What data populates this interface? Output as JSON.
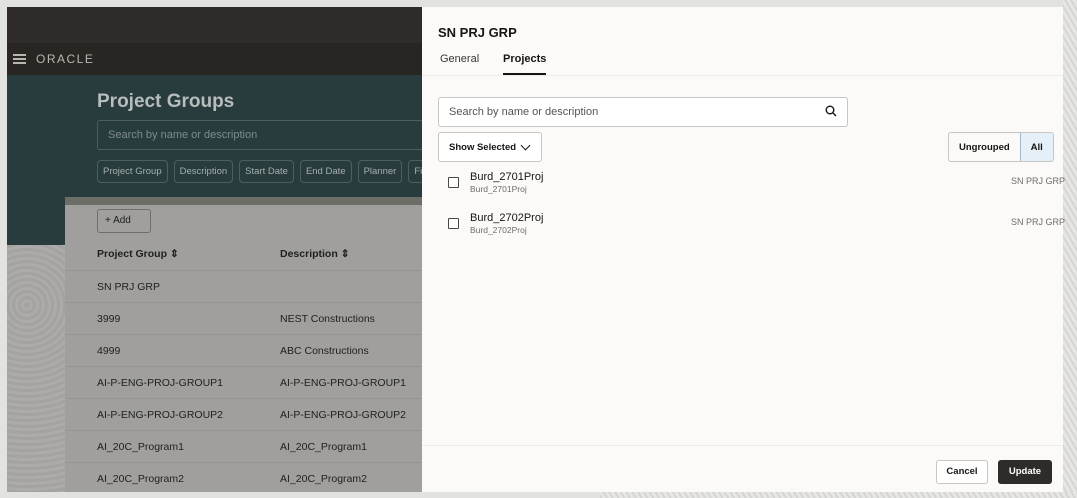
{
  "app": {
    "brand": "ORACLE",
    "page_title": "Project Groups",
    "search_placeholder": "Search by name or description",
    "filters": [
      "Project Group",
      "Description",
      "Start Date",
      "End Date",
      "Planner",
      "Filt"
    ],
    "add_label": "Add",
    "columns": [
      "Project Group",
      "Description"
    ],
    "rows": [
      {
        "group": "SN PRJ GRP",
        "description": ""
      },
      {
        "group": "3999",
        "description": "NEST Constructions"
      },
      {
        "group": "4999",
        "description": "ABC Constructions"
      },
      {
        "group": "AI-P-ENG-PROJ-GROUP1",
        "description": "AI-P-ENG-PROJ-GROUP1"
      },
      {
        "group": "AI-P-ENG-PROJ-GROUP2",
        "description": "AI-P-ENG-PROJ-GROUP2"
      },
      {
        "group": "AI_20C_Program1",
        "description": "AI_20C_Program1"
      },
      {
        "group": "AI_20C_Program2",
        "description": "AI_20C_Program2"
      }
    ]
  },
  "panel": {
    "title": "SN PRJ GRP",
    "tabs": [
      {
        "label": "General",
        "active": false
      },
      {
        "label": "Projects",
        "active": true
      }
    ],
    "search_placeholder": "Search by name or description",
    "show_selected_label": "Show Selected",
    "segments": [
      {
        "label": "Ungrouped",
        "selected": false
      },
      {
        "label": "All",
        "selected": true
      }
    ],
    "projects": [
      {
        "name": "Burd_2701Proj",
        "description": "Burd_2701Proj",
        "group": "SN PRJ GRP",
        "checked": false
      },
      {
        "name": "Burd_2702Proj",
        "description": "Burd_2702Proj",
        "group": "SN PRJ GRP",
        "checked": false
      }
    ],
    "cancel_label": "Cancel",
    "update_label": "Update"
  }
}
